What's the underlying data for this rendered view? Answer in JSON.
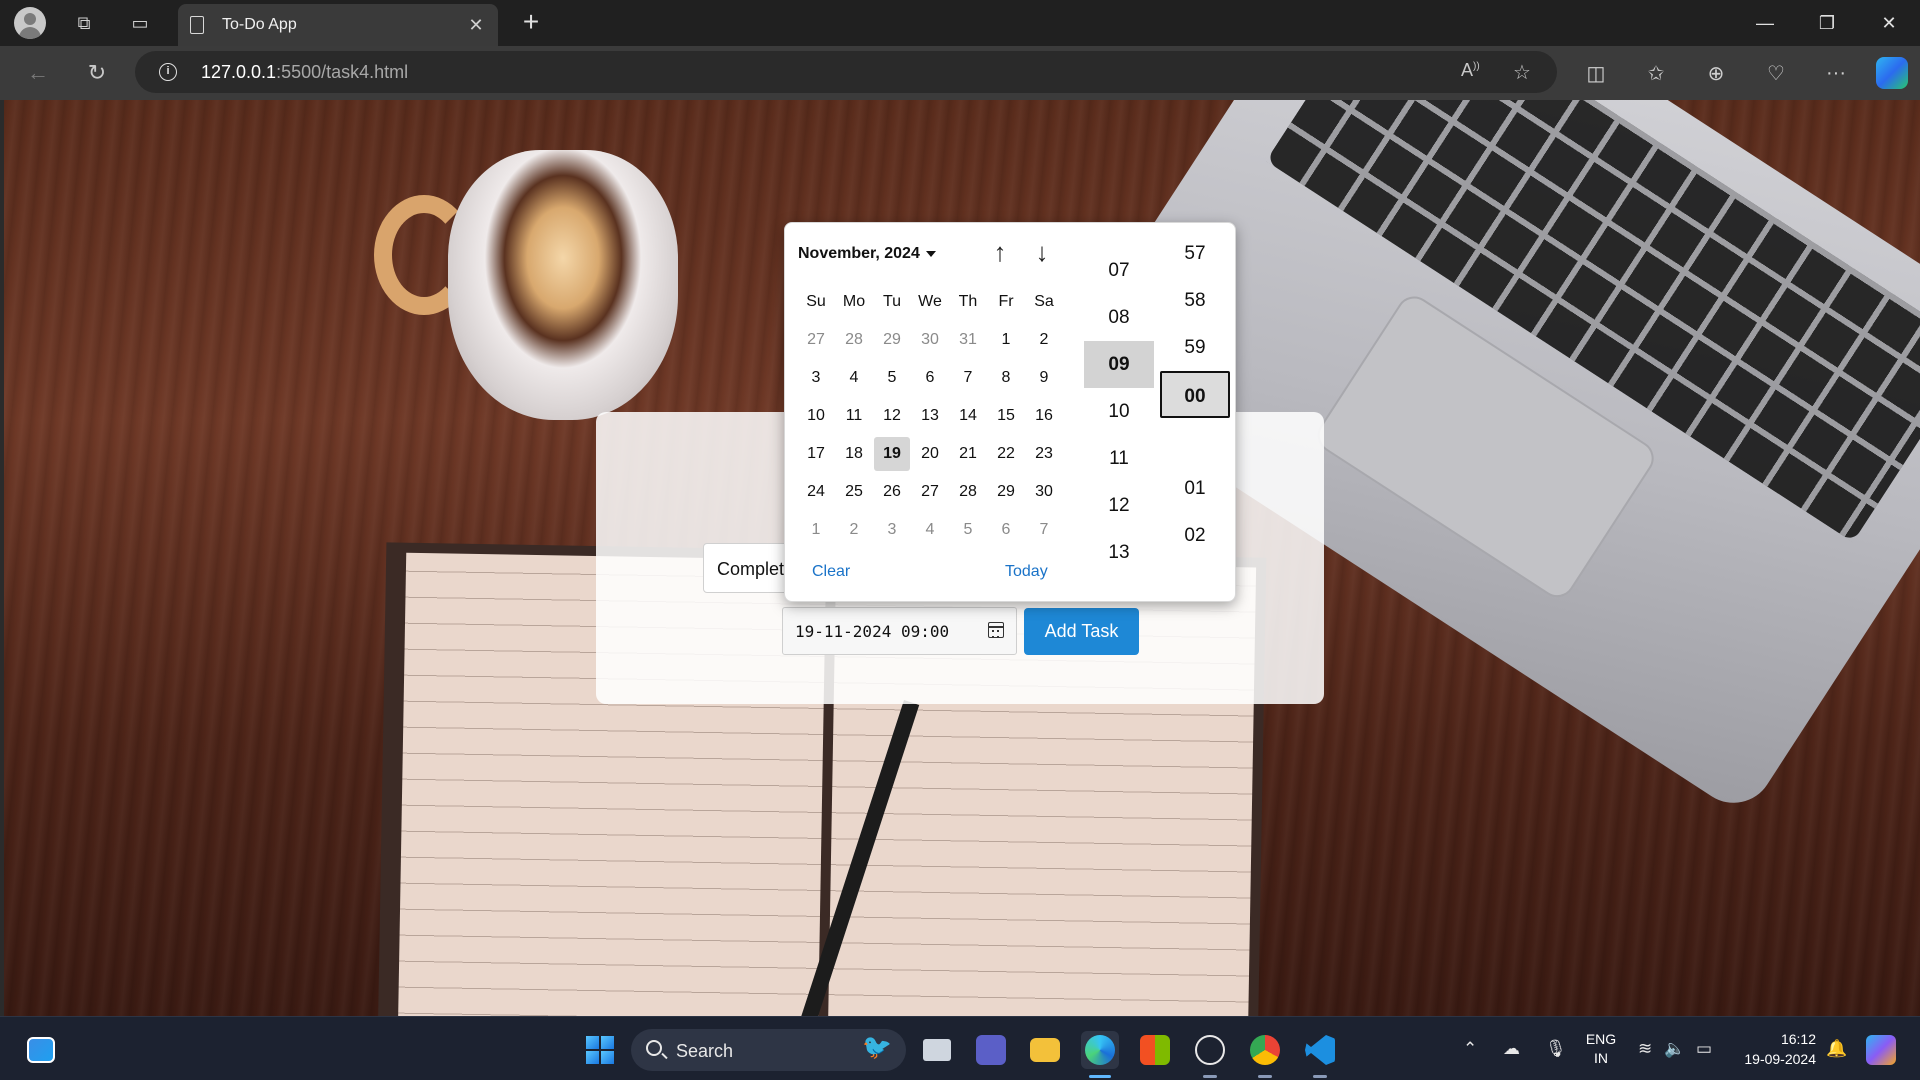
{
  "browser": {
    "tab_title": "To-Do App",
    "tab_close": "✕",
    "new_tab": "+",
    "url_host": "127.0.0.1",
    "url_rest": ":5500/task4.html",
    "win_minimize": "—",
    "win_restore": "❐",
    "win_close": "✕"
  },
  "app": {
    "status_value": "Complet",
    "datetime_value": "19-11-2024 09:00",
    "add_button": "Add Task"
  },
  "picker": {
    "month_label": "November, 2024",
    "up_arrow": "↑",
    "down_arrow": "↓",
    "weekdays": [
      "Su",
      "Mo",
      "Tu",
      "We",
      "Th",
      "Fr",
      "Sa"
    ],
    "days": [
      {
        "d": "27",
        "other": true
      },
      {
        "d": "28",
        "other": true
      },
      {
        "d": "29",
        "other": true
      },
      {
        "d": "30",
        "other": true
      },
      {
        "d": "31",
        "other": true
      },
      {
        "d": "1"
      },
      {
        "d": "2"
      },
      {
        "d": "3"
      },
      {
        "d": "4"
      },
      {
        "d": "5"
      },
      {
        "d": "6"
      },
      {
        "d": "7"
      },
      {
        "d": "8"
      },
      {
        "d": "9"
      },
      {
        "d": "10"
      },
      {
        "d": "11"
      },
      {
        "d": "12"
      },
      {
        "d": "13"
      },
      {
        "d": "14"
      },
      {
        "d": "15"
      },
      {
        "d": "16"
      },
      {
        "d": "17"
      },
      {
        "d": "18"
      },
      {
        "d": "19",
        "selected": true
      },
      {
        "d": "20"
      },
      {
        "d": "21"
      },
      {
        "d": "22"
      },
      {
        "d": "23"
      },
      {
        "d": "24"
      },
      {
        "d": "25"
      },
      {
        "d": "26"
      },
      {
        "d": "27"
      },
      {
        "d": "28"
      },
      {
        "d": "29"
      },
      {
        "d": "30"
      },
      {
        "d": "1",
        "other": true
      },
      {
        "d": "2",
        "other": true
      },
      {
        "d": "3",
        "other": true
      },
      {
        "d": "4",
        "other": true
      },
      {
        "d": "5",
        "other": true
      },
      {
        "d": "6",
        "other": true
      },
      {
        "d": "7",
        "other": true
      }
    ],
    "clear_link": "Clear",
    "today_link": "Today",
    "hours": [
      "07",
      "08",
      "09",
      "10",
      "11",
      "12",
      "13"
    ],
    "selected_hour": "09",
    "minutes": [
      "57",
      "58",
      "59",
      "00",
      "",
      "01",
      "02"
    ],
    "selected_minute": "00"
  },
  "taskbar": {
    "search_label": "Search",
    "lang_top": "ENG",
    "lang_bottom": "IN",
    "time": "16:12",
    "date": "19-09-2024"
  },
  "colors": {
    "accent_button": "#1e88d6",
    "link": "#1a73c8",
    "taskbar": "#1c2230"
  }
}
